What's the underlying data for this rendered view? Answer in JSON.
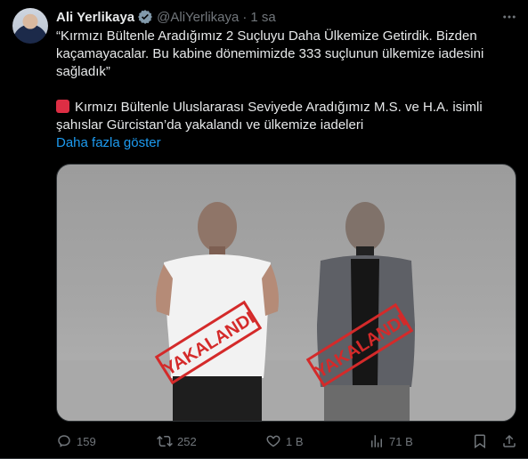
{
  "tweet": {
    "author_name": "Ali Yerlikaya",
    "handle": "@AliYerlikaya",
    "separator": "·",
    "time": "1 sa",
    "text_line1": "“Kırmızı Bültenle Aradığımız 2 Suçluyu Daha Ülkemize Getirdik. Bizden kaçamayacalar. Bu kabine dönemimizde 333 suçlunun ülkemize iadesini sağladık”",
    "text_line2": "Kırmızı Bültenle Uluslararası Seviyede Aradığımız M.S. ve H.A. isimli şahıslar Gürcistan’da yakalandı ve ülkemize iadeleri",
    "show_more": "Daha fazla göster",
    "stamp_text": "YAKALANDI"
  },
  "actions": {
    "replies": "159",
    "reposts": "252",
    "likes": "1 B",
    "views": "71 B"
  },
  "colors": {
    "background": "#000000",
    "text": "#e7e9ea",
    "muted": "#71767b",
    "link": "#1d9bf0",
    "verified": "#829aab",
    "stamp": "#d42a2a"
  },
  "icons": [
    "verified-badge-icon",
    "more-icon",
    "reply-icon",
    "repost-icon",
    "like-icon",
    "views-icon",
    "bookmark-icon",
    "share-icon",
    "red-square-emoji"
  ]
}
